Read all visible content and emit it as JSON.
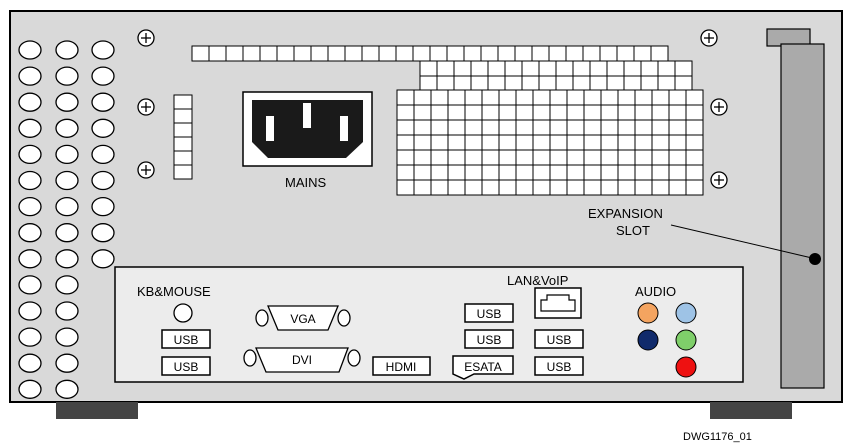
{
  "labels": {
    "mains": "MAINS",
    "expansion_line1": "EXPANSION",
    "expansion_line2": "SLOT",
    "kb_mouse": "KB&MOUSE",
    "lan_voip": "LAN&VoIP",
    "audio": "AUDIO",
    "vga": "VGA",
    "dvi": "DVI",
    "hdmi": "HDMI",
    "esata": "ESATA",
    "usb": "USB",
    "drawing_id": "DWG1176_01"
  },
  "audio_jacks": [
    {
      "name": "audio-jack-orange",
      "color": "#f4a460"
    },
    {
      "name": "audio-jack-light-blue",
      "color": "#9ec3e6"
    },
    {
      "name": "audio-jack-navy",
      "color": "#102a6b"
    },
    {
      "name": "audio-jack-green",
      "color": "#7fcf6a"
    },
    {
      "name": "audio-jack-red",
      "color": "#ee1111"
    }
  ],
  "colors": {
    "chassis": "#d9d9d9",
    "io_panel": "#ececec",
    "expansion_slot": "#aaaaaa",
    "feet": "#444444",
    "mains_socket": "#1a1a1a"
  }
}
